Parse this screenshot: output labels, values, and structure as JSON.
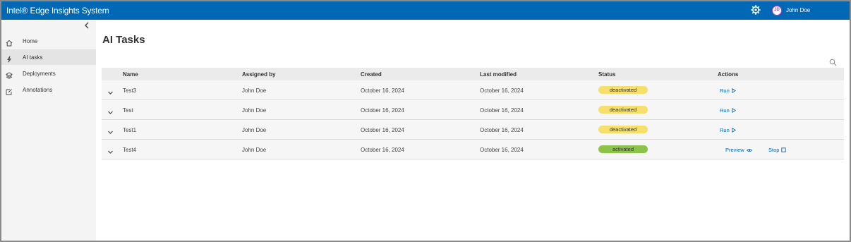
{
  "app": {
    "title": "Intel® Edge Insights System"
  },
  "user": {
    "initials": "JD",
    "name": "John Doe"
  },
  "sidebar": {
    "items": [
      {
        "label": "Home",
        "icon": "home-icon",
        "active": false
      },
      {
        "label": "AI tasks",
        "icon": "ai-tasks-icon",
        "active": true
      },
      {
        "label": "Deployments",
        "icon": "deployments-icon",
        "active": false
      },
      {
        "label": "Annotations",
        "icon": "annotations-icon",
        "active": false
      }
    ]
  },
  "page": {
    "title": "AI Tasks"
  },
  "table": {
    "headers": [
      "Name",
      "Assigned by",
      "Created",
      "Last modified",
      "Status",
      "Actions"
    ],
    "rows": [
      {
        "name": "Test3",
        "assigned_by": "John Doe",
        "created": "October 16, 2024",
        "last_modified": "October 16, 2024",
        "status": "deactivated",
        "actions": [
          "Run"
        ]
      },
      {
        "name": "Test",
        "assigned_by": "John Doe",
        "created": "October 16, 2024",
        "last_modified": "October 16, 2024",
        "status": "deactivated",
        "actions": [
          "Run"
        ]
      },
      {
        "name": "Test1",
        "assigned_by": "John Doe",
        "created": "October 16, 2024",
        "last_modified": "October 16, 2024",
        "status": "deactivated",
        "actions": [
          "Run"
        ]
      },
      {
        "name": "Test4",
        "assigned_by": "John Doe",
        "created": "October 16, 2024",
        "last_modified": "October 16, 2024",
        "status": "activated",
        "actions": [
          "Preview",
          "Stop"
        ]
      }
    ]
  },
  "colors": {
    "brand": "#0068b5",
    "deactivated": "#f6df6b",
    "activated": "#8bc34a",
    "avatar_ring": "#c13ad0"
  }
}
